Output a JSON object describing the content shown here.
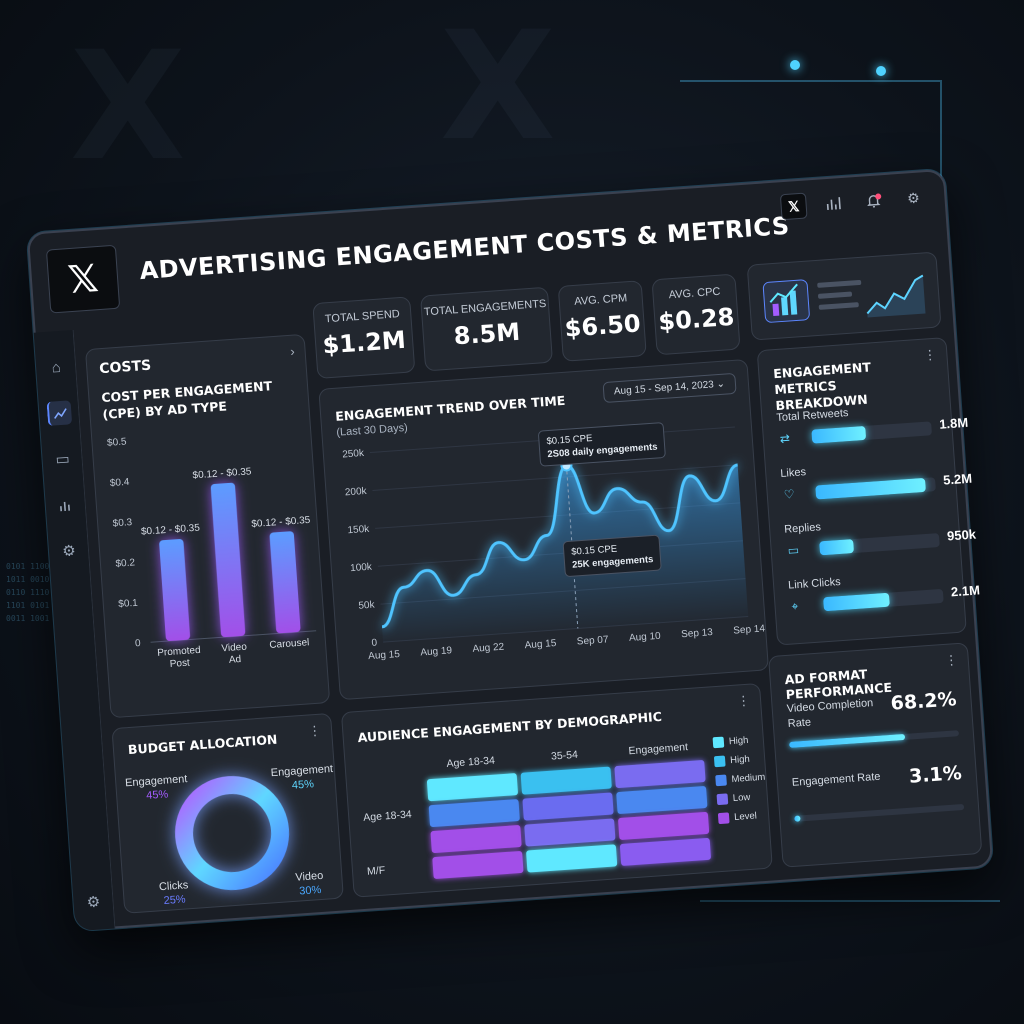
{
  "app": {
    "logo": "𝕏",
    "title": "ADVERTISING ENGAGEMENT COSTS & METRICS"
  },
  "top_icons": [
    "x-logo-icon",
    "analytics-icon",
    "bell-icon",
    "gear-icon"
  ],
  "sidebar_icons": [
    "home-icon",
    "chart-icon",
    "calendar-icon",
    "bar-chart-icon",
    "gear-icon"
  ],
  "kpis": [
    {
      "label": "TOTAL SPEND",
      "value": "$1.2M"
    },
    {
      "label": "TOTAL ENGAGEMENTS",
      "value": "8.5M"
    },
    {
      "label": "AVG. CPM",
      "value": "$6.50"
    },
    {
      "label": "AVG. CPC",
      "value": "$0.28"
    }
  ],
  "costs": {
    "header": "COSTS",
    "subtitle": "COST PER ENGAGEMENT (CPE) BY AD TYPE",
    "chart_data": {
      "type": "bar",
      "categories": [
        "Promoted Post",
        "Video Ad",
        "Carousel"
      ],
      "values": [
        0.25,
        0.38,
        0.25
      ],
      "data_labels": [
        "$0.12 - $0.35",
        "$0.12 - $0.35",
        "$0.12 - $0.35"
      ],
      "yticks": [
        "$0.5",
        "$0.4",
        "$0.3",
        "$0.2",
        "$0.1",
        "0"
      ],
      "ylim": [
        0,
        0.5
      ]
    }
  },
  "trend": {
    "title": "ENGAGEMENT TREND OVER TIME",
    "subtitle": "(Last 30 Days)",
    "date_range": "Aug 15 - Sep 14, 2023",
    "tooltip1": {
      "cpe": "$0.15 CPE",
      "eng": "2S08 daily engagements"
    },
    "tooltip2": {
      "cpe": "$0.15 CPE",
      "eng": "25K engagements"
    },
    "chart_data": {
      "type": "area",
      "x": [
        "Aug 15",
        "Aug 19",
        "Aug 22",
        "Aug 15",
        "Sep 07",
        "Aug 10",
        "Sep 13",
        "Sep 14"
      ],
      "yticks": [
        "250k",
        "200k",
        "150k",
        "100k",
        "50k",
        "0"
      ],
      "ylim": [
        0,
        250000
      ],
      "values": [
        20000,
        70000,
        90000,
        55000,
        80000,
        120000,
        95000,
        125000,
        215000,
        150000,
        180000,
        160000,
        120000,
        190000,
        155000,
        200000
      ]
    }
  },
  "metrics": {
    "title": "ENGAGEMENT METRICS BREAKDOWN",
    "items": [
      {
        "name": "Total Retweets",
        "value": "1.8M",
        "fill": 0.45,
        "icon": "⇄"
      },
      {
        "name": "Likes",
        "value": "5.2M",
        "fill": 0.92,
        "icon": "♡"
      },
      {
        "name": "Replies",
        "value": "950k",
        "fill": 0.28,
        "icon": "▭"
      },
      {
        "name": "Link Clicks",
        "value": "2.1M",
        "fill": 0.55,
        "icon": "⌖"
      }
    ]
  },
  "budget": {
    "title": "BUDGET ALLOCATION",
    "chart_data": {
      "type": "pie",
      "segments": [
        {
          "name": "Engagement",
          "pct": "45%",
          "color": "#a35cff"
        },
        {
          "name": "Engagement",
          "pct": "45%",
          "color": "#5fd7ff"
        },
        {
          "name": "Video",
          "pct": "30%",
          "color": "#4aa8ff"
        },
        {
          "name": "Clicks",
          "pct": "25%",
          "color": "#6a7cff"
        }
      ]
    }
  },
  "demographic": {
    "title": "AUDIENCE ENGAGEMENT BY DEMOGRAPHIC",
    "col_headers": [
      "Age 18-34",
      "35-54",
      "Engagement"
    ],
    "row_labels": [
      "Age 18-34",
      "M/F"
    ],
    "legend": [
      {
        "label": "High",
        "color": "#5fe8ff"
      },
      {
        "label": "High",
        "color": "#3ac0f0"
      },
      {
        "label": "Medium",
        "color": "#4a88f0"
      },
      {
        "label": "Low",
        "color": "#7a6cf0"
      },
      {
        "label": "Level",
        "color": "#a24fe8"
      }
    ],
    "grid": [
      [
        "#5fe8ff",
        "#3ac0f0",
        "#7a6cf0"
      ],
      [
        "#4a88f0",
        "#6a6cf0",
        "#4a88f0"
      ],
      [
        "#a24fe8",
        "#7a6cf0",
        "#a24fe8"
      ],
      [
        "#a24fe8",
        "#5fe8ff",
        "#8a5cf0"
      ]
    ]
  },
  "ad_format": {
    "title": "AD FORMAT PERFORMANCE",
    "items": [
      {
        "name": "Video Completion Rate",
        "value": "68.2%",
        "fill": 0.682
      },
      {
        "name": "Engagement Rate",
        "value": "3.1%",
        "fill": 0.031
      }
    ]
  }
}
